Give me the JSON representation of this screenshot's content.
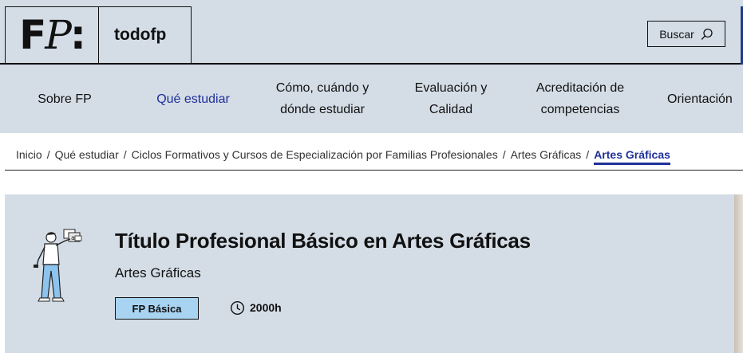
{
  "header": {
    "logo": {
      "letter_f": "F",
      "letter_p": "P",
      "colon": ":"
    },
    "brand": "todofp",
    "search_label": "Buscar",
    "search_icon": "search-icon"
  },
  "nav": {
    "items": [
      {
        "label": "Sobre FP",
        "line1": "Sobre FP",
        "line2": ""
      },
      {
        "label": "Qué estudiar",
        "line1": "Qué estudiar",
        "line2": ""
      },
      {
        "label": "Cómo, cuándo y dónde estudiar",
        "line1": "Cómo, cuándo y",
        "line2": "dónde estudiar"
      },
      {
        "label": "Evaluación y Calidad",
        "line1": "Evaluación y",
        "line2": "Calidad"
      },
      {
        "label": "Acreditación de competencias",
        "line1": "Acreditación de",
        "line2": "competencias"
      },
      {
        "label": "Orientación",
        "line1": "Orientación",
        "line2": ""
      }
    ],
    "active_index": 1,
    "active_color": "#1f2f9a"
  },
  "breadcrumb": {
    "items": [
      "Inicio",
      "Qué estudiar",
      "Ciclos Formativos y Cursos de Especialización por Familias Profesionales",
      "Artes Gráficas"
    ],
    "separator": "/",
    "current": "Artes Gráficas"
  },
  "hero": {
    "title": "Título Profesional Básico en Artes Gráficas",
    "family": "Artes Gráficas",
    "badge": "FP Básica",
    "duration": "2000h",
    "duration_icon": "clock-icon",
    "illustration": "person-with-letters-illustration",
    "badge_color": "#a8d4f2",
    "background_color": "#d4dde6"
  }
}
